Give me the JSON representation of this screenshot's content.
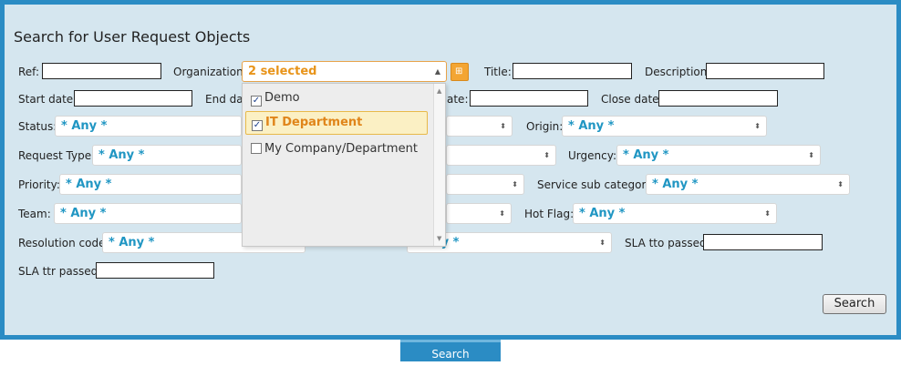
{
  "form": {
    "title": "Search for User Request Objects",
    "fields": {
      "ref": {
        "label": "Ref:",
        "value": ""
      },
      "organization": {
        "label": "Organization:",
        "value": "2 selected"
      },
      "title": {
        "label": "Title:",
        "value": ""
      },
      "description": {
        "label": "Description:",
        "value": ""
      },
      "start_date": {
        "label": "Start date:",
        "value": ""
      },
      "end_date": {
        "label": "End date",
        "value": ""
      },
      "x_date": {
        "label": "ate:",
        "value": ""
      },
      "close_date": {
        "label": "Close date:",
        "value": ""
      },
      "status": {
        "label": "Status:",
        "value": "* Any *"
      },
      "origin": {
        "label": "Origin:",
        "value": "* Any *"
      },
      "request_type": {
        "label": "Request Type:",
        "value": "* Any *"
      },
      "urgency": {
        "label": "Urgency:",
        "value": "* Any *"
      },
      "priority": {
        "label": "Priority:",
        "value": "* Any *"
      },
      "service_sub_category": {
        "label": "Service sub category:",
        "value": "* Any *"
      },
      "team": {
        "label": "Team:",
        "value": "* Any *"
      },
      "hot_flag": {
        "label": "Hot Flag:",
        "value": "* Any *"
      },
      "resolution_code": {
        "label": "Resolution code:",
        "value": "* Any *"
      },
      "hidden_select": {
        "value": "* Any *"
      },
      "sla_tto_passed": {
        "label": "SLA tto passed:",
        "value": ""
      },
      "sla_ttr_passed": {
        "label": "SLA ttr passed:",
        "value": ""
      }
    },
    "org_dropdown": {
      "options": [
        {
          "label": "Demo",
          "checked": true
        },
        {
          "label": "IT Department",
          "checked": true
        },
        {
          "label": "My Company/Department",
          "checked": false
        }
      ]
    },
    "search_button": "Search",
    "bottom_tab": "Search"
  },
  "icons": {
    "select_arrow": "up-down-arrow-icon",
    "org_button": "hierarchy-icon",
    "checkbox": "check-icon"
  },
  "colors": {
    "accent": "#2b8cc4",
    "panel_bg": "#d5e6ef",
    "select_value": "#2096c3",
    "highlight": "#e0851a"
  }
}
